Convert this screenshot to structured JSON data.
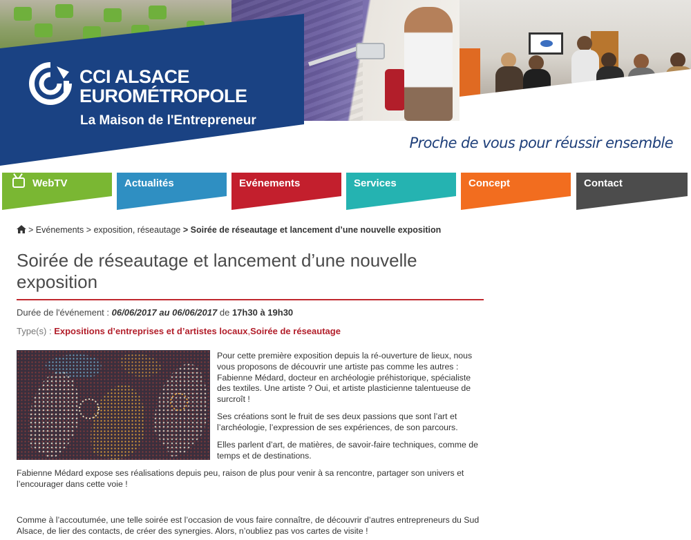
{
  "header": {
    "brand_line1": "CCI ALSACE",
    "brand_line2": "EUROMÉTROPOLE",
    "brand_sub": "La Maison de l'Entrepreneur",
    "slogan": "Proche de vous pour réussir ensemble",
    "brand_color": "#1a4283",
    "slogan_color": "#1e3f7a"
  },
  "nav": {
    "items": [
      {
        "label": "WebTV",
        "color": "#7ab733",
        "icon": "tv-icon"
      },
      {
        "label": "Actualités",
        "color": "#2f8fc2"
      },
      {
        "label": "Evénements",
        "color": "#c31f2d"
      },
      {
        "label": "Services",
        "color": "#25b3b1"
      },
      {
        "label": "Concept",
        "color": "#f26d1f"
      },
      {
        "label": "Contact",
        "color": "#4c4c4c"
      }
    ]
  },
  "breadcrumb": {
    "home_icon": "home-icon",
    "sep": ">",
    "items": [
      "Evénements",
      "exposition, réseautage"
    ],
    "current": "Soirée de réseautage et lancement d’une nouvelle exposition"
  },
  "event": {
    "title": "Soirée de réseautage et lancement d’une nouvelle exposition",
    "duration_label": "Durée de l'événement :",
    "date_from": "06/06/2017",
    "date_joiner": "au",
    "date_to": "06/06/2017",
    "time_prefix": "de",
    "time_from": "17h30",
    "time_joiner": "à",
    "time_to": "19h30",
    "types_label": "Type(s) :",
    "types": [
      "Expositions d’entreprises et d’artistes locaux",
      "Soirée de réseautage"
    ],
    "types_separator": ",",
    "accent_color": "#c0272d",
    "paragraphs": [
      "Pour cette première exposition depuis la ré-ouverture de lieux, nous vous proposons de découvrir une artiste pas comme les autres : Fabienne Médard, docteur en archéologie préhistorique, spécialiste des textiles.  Une artiste ? Oui, et artiste plasticienne talentueuse de surcroît !",
      "Ses créations sont le fruit de ses deux passions que sont l’art et l’archéologie, l’expression de ses expériences, de son parcours.",
      "Elles parlent d’art, de matières, de savoir-faire techniques, comme de temps et de destinations.",
      "Fabienne Médard expose ses réalisations depuis peu, raison de plus pour venir à sa rencontre,  partager son univers et l’encourager dans cette voie !",
      "Comme à l’accoutumée, une telle soirée est l’occasion de vous faire connaître, de découvrir d’autres entrepreneurs du Sud Alsace, de lier des contacts, de créer des synergies. Alors, n’oubliez pas vos cartes de visite !"
    ]
  }
}
